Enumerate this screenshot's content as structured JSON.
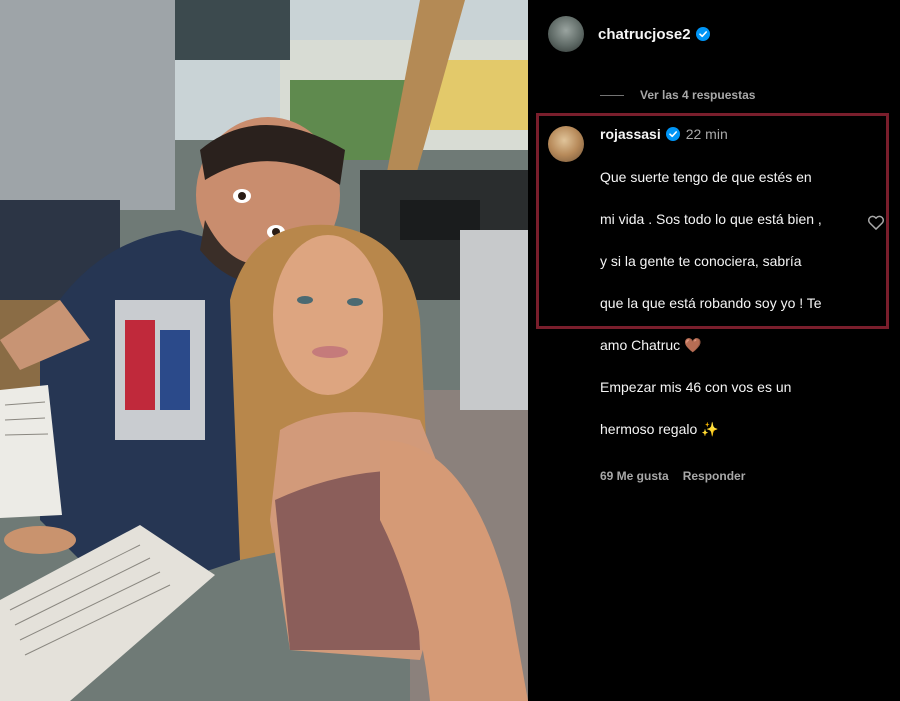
{
  "post": {
    "author": "chatrucjose2",
    "author_verified": true
  },
  "replies": {
    "view_label": "Ver las 4 respuestas"
  },
  "comment": {
    "username": "rojassasi",
    "verified": true,
    "time": "22 min",
    "text_lines": [
      "Que suerte tengo de que estés en",
      "mi vida . Sos todo lo que está bien ,",
      "y si la gente te conociera, sabría",
      "que la que está robando soy yo ! Te",
      "amo Chatruc 🤎",
      "Empezar mis 46 con vos es un",
      "hermoso regalo ✨"
    ],
    "likes": "69 Me gusta",
    "reply_label": "Responder"
  },
  "colors": {
    "background": "#000000",
    "text_primary": "#f5f5f5",
    "text_secondary": "#a8a8a8",
    "verified_blue": "#0095f6",
    "highlight_border": "#7a1e2c"
  },
  "icons": [
    "verified-badge-icon",
    "heart-outline-icon"
  ]
}
